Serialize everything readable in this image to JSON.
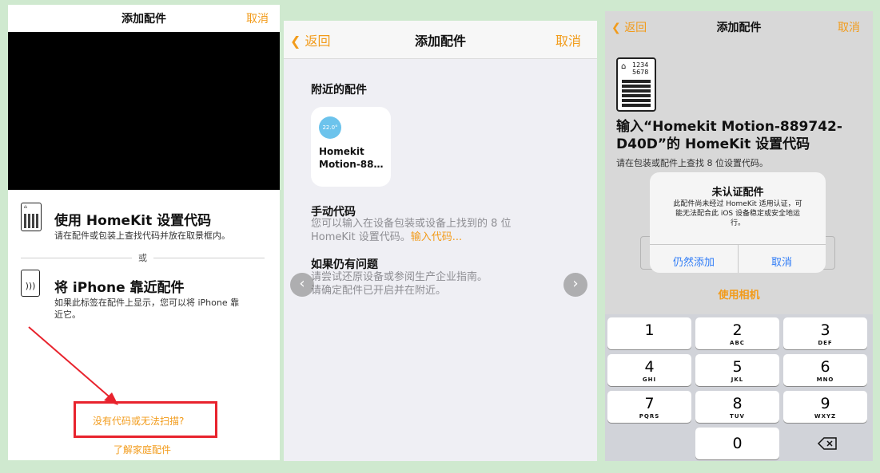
{
  "panel1": {
    "title": "添加配件",
    "cancel": "取消",
    "option1_title": "使用 HomeKit 设置代码",
    "option1_desc": "请在配件或包装上查找代码并放在取景框内。",
    "or": "或",
    "option2_title": "将 iPhone 靠近配件",
    "option2_desc_line1": "如果此标签在配件上显示，您可以将 iPhone 靠",
    "option2_desc_line2": "近它。",
    "no_code_link": "没有代码或无法扫描?",
    "learn_link": "了解家庭配件"
  },
  "panel2": {
    "back": "返回",
    "title": "添加配件",
    "cancel": "取消",
    "nearby_heading": "附近的配件",
    "tile_temp": "22.0°",
    "tile_name_line1": "Homekit",
    "tile_name_line2": "Motion-88…",
    "manual_heading": "手动代码",
    "manual_line1": "您可以输入在设备包装或设备上找到的 8 位",
    "manual_line2": "HomeKit 设置代码。",
    "manual_link": "输入代码...",
    "problem_heading": "如果仍有问题",
    "problem_line1": "请尝试还原设备或参阅生产企业指南。",
    "problem_line2": "请确定配件已开启并在附近。"
  },
  "panel3": {
    "back": "返回",
    "title": "添加配件",
    "cancel": "取消",
    "code_digits_top": "1234",
    "code_digits_bottom": "5678",
    "headline_line1": "输入“Homekit Motion-889742-",
    "headline_line2": "D40D”的 HomeKit 设置代码",
    "sub": "请在包装或配件上查找 8 位设置代码。",
    "alert_title": "未认证配件",
    "alert_msg_line1": "此配件尚未经过 HomeKit 适用认证，可",
    "alert_msg_line2": "能无法配合此 iOS 设备稳定或安全地运",
    "alert_msg_line3": "行。",
    "alert_add": "仍然添加",
    "alert_cancel": "取消",
    "use_camera": "使用相机"
  },
  "keypad": [
    {
      "d": "1",
      "l": ""
    },
    {
      "d": "2",
      "l": "ABC"
    },
    {
      "d": "3",
      "l": "DEF"
    },
    {
      "d": "4",
      "l": "GHI"
    },
    {
      "d": "5",
      "l": "JKL"
    },
    {
      "d": "6",
      "l": "MNO"
    },
    {
      "d": "7",
      "l": "PQRS"
    },
    {
      "d": "8",
      "l": "TUV"
    },
    {
      "d": "9",
      "l": "WXYZ"
    },
    {
      "d": "0",
      "l": ""
    }
  ],
  "colors": {
    "accent": "#f29b1a",
    "alert_blue": "#2f7cf6",
    "annotation_red": "#e8232d",
    "background": "#cfe9cf"
  }
}
